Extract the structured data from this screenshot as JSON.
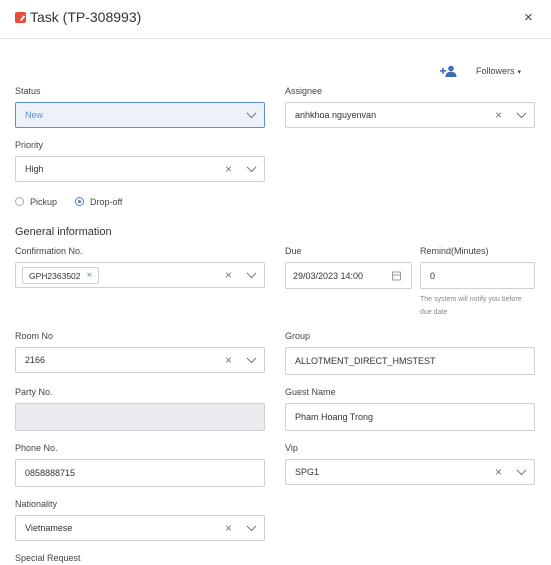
{
  "header": {
    "title": "Task (TP-308993)",
    "close_icon": "close-icon",
    "task_icon": "task-icon",
    "accent": "#e74c3c"
  },
  "followers": {
    "label": "Followers",
    "icon": "add-follower-icon",
    "caret": "▾"
  },
  "status": {
    "label": "Status",
    "value": "New"
  },
  "assignee": {
    "label": "Assignee",
    "value": "anhkhoa nguyenvan"
  },
  "priority": {
    "label": "Priority",
    "value": "High"
  },
  "delivery": {
    "options": [
      "Pickup",
      "Drop-off"
    ],
    "selected": "Drop-off"
  },
  "section_title": "General information",
  "confirmation": {
    "label": "Confirmation No.",
    "tag": "GPH2363502"
  },
  "due": {
    "label": "Due",
    "value": "29/03/2023 14:00"
  },
  "remind": {
    "label": "Remind(Minutes)",
    "value": "0",
    "hint_line1": "The system will notify you before",
    "hint_line2": "due date"
  },
  "room": {
    "label": "Room No",
    "value": "2166"
  },
  "group": {
    "label": "Group",
    "value": "ALLOTMENT_DIRECT_HMSTEST"
  },
  "party": {
    "label": "Party No.",
    "value": ""
  },
  "guest": {
    "label": "Guest Name",
    "value": "Pham Hoang Trong"
  },
  "phone": {
    "label": "Phone No.",
    "value": "0858888715"
  },
  "vip": {
    "label": "Vip",
    "value": "SPG1"
  },
  "nationality": {
    "label": "Nationality",
    "value": "Vietnamese"
  },
  "special": {
    "label": "Special Request"
  },
  "glyphs": {
    "clear": "×",
    "close": "×"
  },
  "colors": {
    "accent_blue": "#4a7fc9",
    "active_bg": "#edf2fa"
  }
}
